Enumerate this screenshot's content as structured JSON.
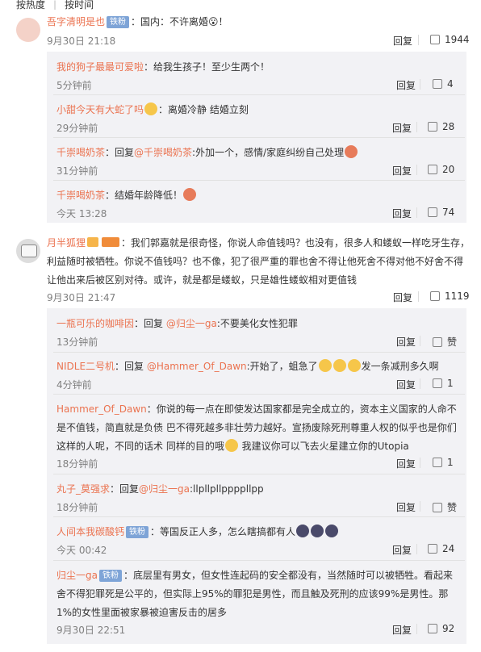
{
  "topbar": {
    "tab1": "按热度",
    "tab2": "按时间"
  },
  "comments": [
    {
      "user": "吾字清明是也",
      "badge": "铁粉",
      "text": "：国内：不许离婚😮！",
      "time": "9月30日 21:18",
      "reply": "回复",
      "likes": "1944",
      "replies": [
        {
          "user": "我的狗子最最可爱啦",
          "text": "：给我生孩子！至少生两个！",
          "time": "5分钟前",
          "reply": "回复",
          "likes": "4"
        },
        {
          "user": "小甜今天有大蛇了吗",
          "text": "：离婚冷静 结婚立刻",
          "time": "29分钟前",
          "reply": "回复",
          "likes": "28"
        },
        {
          "user": "千崇喝奶茶",
          "pre": "：回复",
          "mention": "@千崇喝奶茶",
          "text": ":外加一个，感情/家庭纠纷自己处理",
          "time": "31分钟前",
          "reply": "回复",
          "likes": "20"
        },
        {
          "user": "千崇喝奶茶",
          "text": "：结婚年龄降低！",
          "time": "今天 13:28",
          "reply": "回复",
          "likes": "74"
        }
      ]
    },
    {
      "user": "月半狐狸",
      "text_l1": "：我们郭嘉就是很奇怪，你说人命值钱吗？也没有，很多人和蝼蚁一样吃牙生存，",
      "text_l2": "利益随时被牺牲。你说不值钱吗？也不像，犯了很严重的罪也舍不得让他死舍不得对他不好舍不得",
      "text_l3": "让他出来后被区别对待。或许，就是都是蝼蚁，只是雄性蝼蚁相对更值钱",
      "time": "9月30日 21:47",
      "reply": "回复",
      "likes": "1119",
      "replies": [
        {
          "user": "一瓶可乐的咖啡因",
          "pre": "：回复 ",
          "mention": "@归尘一ga",
          "text": ":不要美化女性犯罪",
          "time": "13分钟前",
          "reply": "回复",
          "likes": "赞"
        },
        {
          "user": "NIDLE二号机",
          "pre": "：回复 ",
          "mention": "@Hammer_Of_Dawn",
          "text": ":开始了，蛆急了",
          "text2": "发一条减刑多久啊",
          "time": "4分钟前",
          "reply": "回复",
          "likes": "1"
        },
        {
          "user": "Hammer_Of_Dawn",
          "l1": "：你说的每一点在即使发达国家都是完全成立的，资本主义国家的人命不",
          "l2": "是不值钱，简直就是负债 巴不得死越多非壮劳力越好。宣扬废除死刑尊重人权的似乎也是你们",
          "l3": "这样的人呢，不同的话术 同样的目的哦",
          "l3b": " 我建议你可以飞去火星建立你的Utopia",
          "time": "18分钟前",
          "reply": "回复",
          "likes": "1"
        },
        {
          "user": "丸子_莫强求",
          "pre": "：回复",
          "mention": "@归尘一ga",
          "text": ":llpllpllppppllpp",
          "time": "18分钟前",
          "reply": "回复",
          "likes": "赞"
        },
        {
          "user": "人间本我碳酸钙",
          "badge": "铁粉",
          "text": "：等国反正人多，怎么瞎搞都有人",
          "time": "今天 00:42",
          "reply": "回复",
          "likes": "24"
        },
        {
          "user": "归尘一ga",
          "badge": "铁粉",
          "l1": "：底层里有男女，但女性连起码的安全都没有，当然随时可以被牺牲。看起来",
          "l2": "舍不得犯罪死是公平的，但实际上95%的罪犯是男性，而且触及死刑的应该99%是男性。那",
          "l3": "1%的女性里面被家暴被迫害反击的居多",
          "time": "9月30日 22:51",
          "reply": "回复",
          "likes": "92"
        }
      ]
    }
  ]
}
